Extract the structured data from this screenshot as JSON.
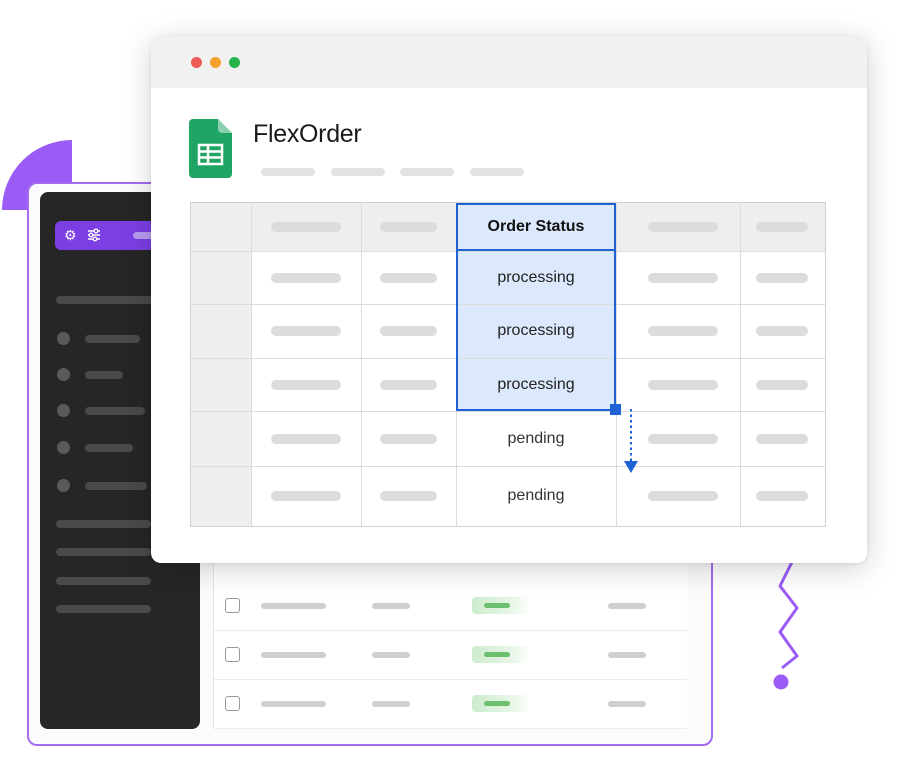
{
  "window": {
    "traffic_lights": [
      "#ee5a55",
      "#f4a12b",
      "#27b24a"
    ]
  },
  "app": {
    "title": "FlexOrder",
    "icon": "google-sheets-icon"
  },
  "sheet": {
    "selected_column_header": "Order Status",
    "rows": [
      {
        "status": "processing",
        "selected": true
      },
      {
        "status": "processing",
        "selected": true
      },
      {
        "status": "processing",
        "selected": true
      },
      {
        "status": "pending",
        "selected": false
      },
      {
        "status": "pending",
        "selected": false
      }
    ]
  },
  "background_app": {
    "toolbar_icons": [
      "gear-icon",
      "sliders-icon"
    ],
    "accent": "#7b3fe4"
  },
  "colors": {
    "selection_border": "#1e62d6",
    "selection_fill": "#dce8fb",
    "decoration_purple": "#9b5cf6",
    "sheets_green": "#1fa463"
  }
}
